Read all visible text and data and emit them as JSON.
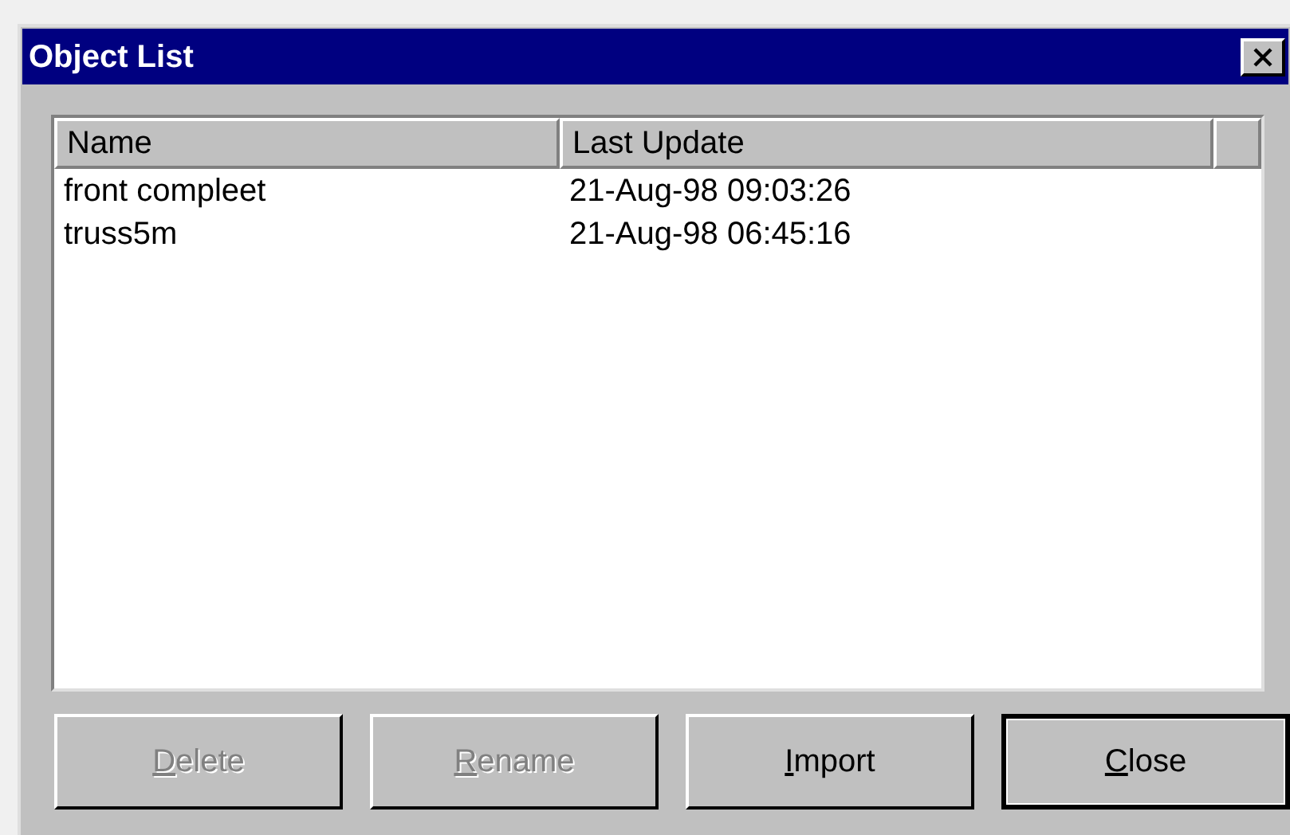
{
  "window": {
    "title": "Object List"
  },
  "table": {
    "columns": [
      "Name",
      "Last Update"
    ],
    "rows": [
      [
        "front compleet",
        "21-Aug-98 09:03:26"
      ],
      [
        "truss5m",
        "21-Aug-98 06:45:16"
      ]
    ]
  },
  "buttons": [
    {
      "label": "Delete",
      "disabled": true,
      "default": false
    },
    {
      "label": "Rename",
      "disabled": true,
      "default": false
    },
    {
      "label": "Import",
      "disabled": false,
      "default": false
    },
    {
      "label": "Close",
      "disabled": false,
      "default": true
    }
  ]
}
